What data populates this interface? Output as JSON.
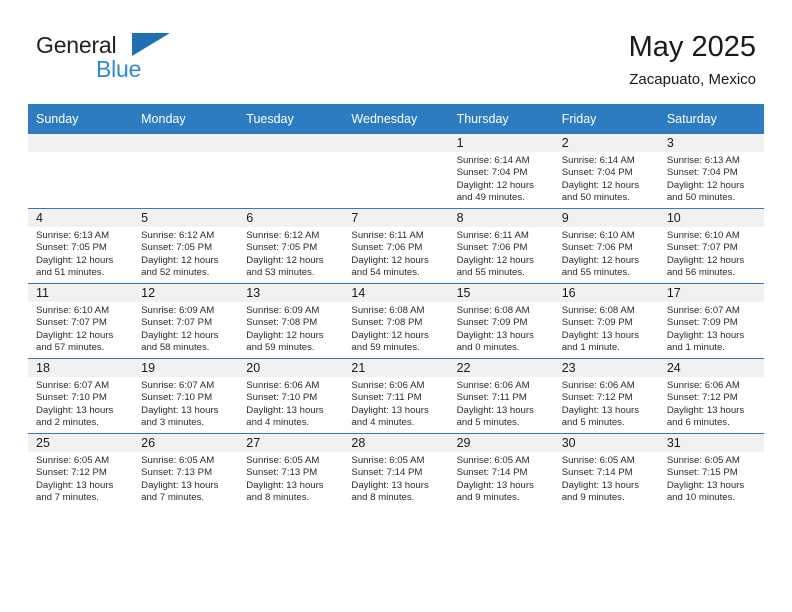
{
  "brand": {
    "line1": "General",
    "line2": "Blue",
    "triangle_color": "#1f6fb5",
    "blue_text_color": "#2e8bd0"
  },
  "header": {
    "title": "May 2025",
    "subtitle": "Zacapuato, Mexico",
    "header_bg_color": "#2e7cc0",
    "daynum_band_color": "#f1f1f1"
  },
  "weekdays": [
    "Sunday",
    "Monday",
    "Tuesday",
    "Wednesday",
    "Thursday",
    "Friday",
    "Saturday"
  ],
  "weeks": [
    [
      {
        "day": "",
        "sunrise": "",
        "sunset": "",
        "daylight1": "",
        "daylight2": ""
      },
      {
        "day": "",
        "sunrise": "",
        "sunset": "",
        "daylight1": "",
        "daylight2": ""
      },
      {
        "day": "",
        "sunrise": "",
        "sunset": "",
        "daylight1": "",
        "daylight2": ""
      },
      {
        "day": "",
        "sunrise": "",
        "sunset": "",
        "daylight1": "",
        "daylight2": ""
      },
      {
        "day": "1",
        "sunrise": "Sunrise: 6:14 AM",
        "sunset": "Sunset: 7:04 PM",
        "daylight1": "Daylight: 12 hours",
        "daylight2": "and 49 minutes."
      },
      {
        "day": "2",
        "sunrise": "Sunrise: 6:14 AM",
        "sunset": "Sunset: 7:04 PM",
        "daylight1": "Daylight: 12 hours",
        "daylight2": "and 50 minutes."
      },
      {
        "day": "3",
        "sunrise": "Sunrise: 6:13 AM",
        "sunset": "Sunset: 7:04 PM",
        "daylight1": "Daylight: 12 hours",
        "daylight2": "and 50 minutes."
      }
    ],
    [
      {
        "day": "4",
        "sunrise": "Sunrise: 6:13 AM",
        "sunset": "Sunset: 7:05 PM",
        "daylight1": "Daylight: 12 hours",
        "daylight2": "and 51 minutes."
      },
      {
        "day": "5",
        "sunrise": "Sunrise: 6:12 AM",
        "sunset": "Sunset: 7:05 PM",
        "daylight1": "Daylight: 12 hours",
        "daylight2": "and 52 minutes."
      },
      {
        "day": "6",
        "sunrise": "Sunrise: 6:12 AM",
        "sunset": "Sunset: 7:05 PM",
        "daylight1": "Daylight: 12 hours",
        "daylight2": "and 53 minutes."
      },
      {
        "day": "7",
        "sunrise": "Sunrise: 6:11 AM",
        "sunset": "Sunset: 7:06 PM",
        "daylight1": "Daylight: 12 hours",
        "daylight2": "and 54 minutes."
      },
      {
        "day": "8",
        "sunrise": "Sunrise: 6:11 AM",
        "sunset": "Sunset: 7:06 PM",
        "daylight1": "Daylight: 12 hours",
        "daylight2": "and 55 minutes."
      },
      {
        "day": "9",
        "sunrise": "Sunrise: 6:10 AM",
        "sunset": "Sunset: 7:06 PM",
        "daylight1": "Daylight: 12 hours",
        "daylight2": "and 55 minutes."
      },
      {
        "day": "10",
        "sunrise": "Sunrise: 6:10 AM",
        "sunset": "Sunset: 7:07 PM",
        "daylight1": "Daylight: 12 hours",
        "daylight2": "and 56 minutes."
      }
    ],
    [
      {
        "day": "11",
        "sunrise": "Sunrise: 6:10 AM",
        "sunset": "Sunset: 7:07 PM",
        "daylight1": "Daylight: 12 hours",
        "daylight2": "and 57 minutes."
      },
      {
        "day": "12",
        "sunrise": "Sunrise: 6:09 AM",
        "sunset": "Sunset: 7:07 PM",
        "daylight1": "Daylight: 12 hours",
        "daylight2": "and 58 minutes."
      },
      {
        "day": "13",
        "sunrise": "Sunrise: 6:09 AM",
        "sunset": "Sunset: 7:08 PM",
        "daylight1": "Daylight: 12 hours",
        "daylight2": "and 59 minutes."
      },
      {
        "day": "14",
        "sunrise": "Sunrise: 6:08 AM",
        "sunset": "Sunset: 7:08 PM",
        "daylight1": "Daylight: 12 hours",
        "daylight2": "and 59 minutes."
      },
      {
        "day": "15",
        "sunrise": "Sunrise: 6:08 AM",
        "sunset": "Sunset: 7:09 PM",
        "daylight1": "Daylight: 13 hours",
        "daylight2": "and 0 minutes."
      },
      {
        "day": "16",
        "sunrise": "Sunrise: 6:08 AM",
        "sunset": "Sunset: 7:09 PM",
        "daylight1": "Daylight: 13 hours",
        "daylight2": "and 1 minute."
      },
      {
        "day": "17",
        "sunrise": "Sunrise: 6:07 AM",
        "sunset": "Sunset: 7:09 PM",
        "daylight1": "Daylight: 13 hours",
        "daylight2": "and 1 minute."
      }
    ],
    [
      {
        "day": "18",
        "sunrise": "Sunrise: 6:07 AM",
        "sunset": "Sunset: 7:10 PM",
        "daylight1": "Daylight: 13 hours",
        "daylight2": "and 2 minutes."
      },
      {
        "day": "19",
        "sunrise": "Sunrise: 6:07 AM",
        "sunset": "Sunset: 7:10 PM",
        "daylight1": "Daylight: 13 hours",
        "daylight2": "and 3 minutes."
      },
      {
        "day": "20",
        "sunrise": "Sunrise: 6:06 AM",
        "sunset": "Sunset: 7:10 PM",
        "daylight1": "Daylight: 13 hours",
        "daylight2": "and 4 minutes."
      },
      {
        "day": "21",
        "sunrise": "Sunrise: 6:06 AM",
        "sunset": "Sunset: 7:11 PM",
        "daylight1": "Daylight: 13 hours",
        "daylight2": "and 4 minutes."
      },
      {
        "day": "22",
        "sunrise": "Sunrise: 6:06 AM",
        "sunset": "Sunset: 7:11 PM",
        "daylight1": "Daylight: 13 hours",
        "daylight2": "and 5 minutes."
      },
      {
        "day": "23",
        "sunrise": "Sunrise: 6:06 AM",
        "sunset": "Sunset: 7:12 PM",
        "daylight1": "Daylight: 13 hours",
        "daylight2": "and 5 minutes."
      },
      {
        "day": "24",
        "sunrise": "Sunrise: 6:06 AM",
        "sunset": "Sunset: 7:12 PM",
        "daylight1": "Daylight: 13 hours",
        "daylight2": "and 6 minutes."
      }
    ],
    [
      {
        "day": "25",
        "sunrise": "Sunrise: 6:05 AM",
        "sunset": "Sunset: 7:12 PM",
        "daylight1": "Daylight: 13 hours",
        "daylight2": "and 7 minutes."
      },
      {
        "day": "26",
        "sunrise": "Sunrise: 6:05 AM",
        "sunset": "Sunset: 7:13 PM",
        "daylight1": "Daylight: 13 hours",
        "daylight2": "and 7 minutes."
      },
      {
        "day": "27",
        "sunrise": "Sunrise: 6:05 AM",
        "sunset": "Sunset: 7:13 PM",
        "daylight1": "Daylight: 13 hours",
        "daylight2": "and 8 minutes."
      },
      {
        "day": "28",
        "sunrise": "Sunrise: 6:05 AM",
        "sunset": "Sunset: 7:14 PM",
        "daylight1": "Daylight: 13 hours",
        "daylight2": "and 8 minutes."
      },
      {
        "day": "29",
        "sunrise": "Sunrise: 6:05 AM",
        "sunset": "Sunset: 7:14 PM",
        "daylight1": "Daylight: 13 hours",
        "daylight2": "and 9 minutes."
      },
      {
        "day": "30",
        "sunrise": "Sunrise: 6:05 AM",
        "sunset": "Sunset: 7:14 PM",
        "daylight1": "Daylight: 13 hours",
        "daylight2": "and 9 minutes."
      },
      {
        "day": "31",
        "sunrise": "Sunrise: 6:05 AM",
        "sunset": "Sunset: 7:15 PM",
        "daylight1": "Daylight: 13 hours",
        "daylight2": "and 10 minutes."
      }
    ]
  ]
}
